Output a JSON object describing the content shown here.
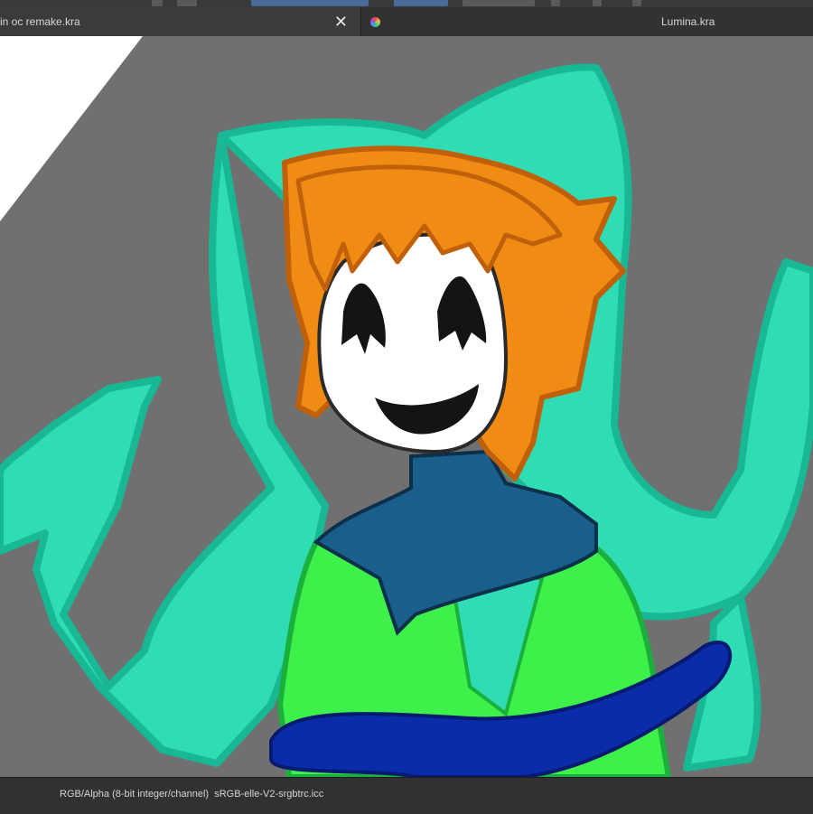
{
  "tabs": [
    {
      "label": "in oc remake.kra",
      "close_icon": "close-icon",
      "active": true
    },
    {
      "label": "Lumina.kra",
      "icon": "krita-document-icon",
      "active": false
    }
  ],
  "status": {
    "color_model": "RGB/Alpha (8-bit integer/channel)",
    "color_profile": "sRGB-elle-V2-srgbtrc.icc"
  },
  "colors": {
    "canvas_bg": "#707070",
    "page_white": "#ffffff",
    "aura": "#2fdcb4",
    "hair": "#f08c14",
    "mask": "#ffffff",
    "collar": "#1a5e8c",
    "shirt": "#3ef04a",
    "ribbon": "#0a2ca8"
  }
}
